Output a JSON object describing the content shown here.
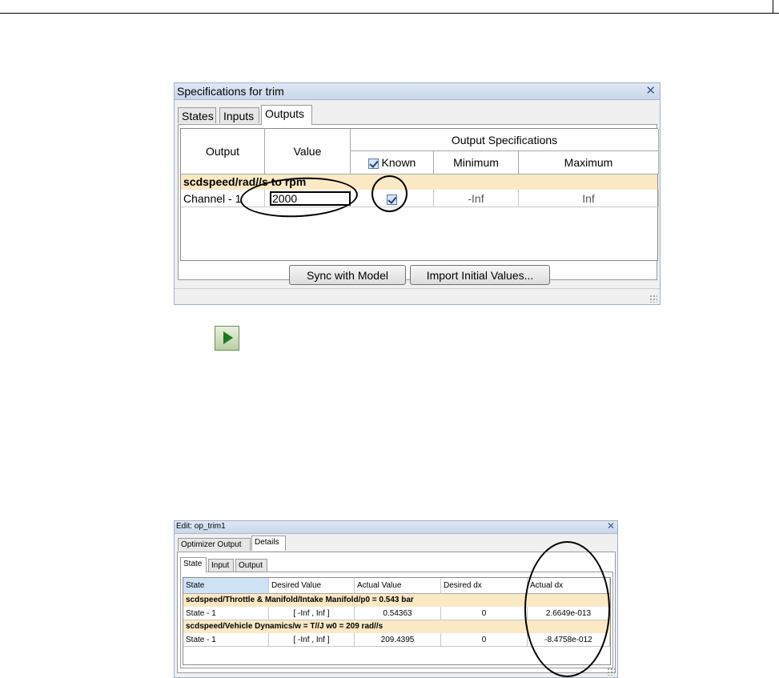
{
  "trim_dialog": {
    "title": "Specifications for trim",
    "close_glyph": "✕",
    "tabs": [
      {
        "label": "States"
      },
      {
        "label": "Inputs"
      },
      {
        "label": "Outputs"
      }
    ],
    "active_tab": "Outputs",
    "table": {
      "col_output": "Output",
      "col_value": "Value",
      "col_group": "Output Specifications",
      "col_known": "Known",
      "col_minimum": "Minimum",
      "col_maximum": "Maximum",
      "group_label": "scdspeed/rad//s to rpm",
      "row": {
        "output": "Channel - 1",
        "value": "2000",
        "known": true,
        "minimum": "-Inf",
        "maximum": "Inf"
      }
    },
    "buttons": {
      "sync": "Sync with Model",
      "import": "Import Initial Values..."
    }
  },
  "run_icon": "play-icon",
  "op_dialog": {
    "title": "Edit: op_trim1",
    "close_glyph": "✕",
    "tabs": [
      {
        "label": "Optimizer Output"
      },
      {
        "label": "Details"
      }
    ],
    "subtabs": [
      {
        "label": "State"
      },
      {
        "label": "Input"
      },
      {
        "label": "Output"
      }
    ],
    "columns": [
      "State",
      "Desired Value",
      "Actual Value",
      "Desired dx",
      "Actual dx"
    ],
    "groups": [
      {
        "label": "scdspeed/Throttle & Manifold/Intake Manifold/p0 = 0.543 bar",
        "row": [
          "State - 1",
          "[ -Inf , Inf ]",
          "0.54363",
          "0",
          "2.6649e-013"
        ]
      },
      {
        "label": "scdspeed/Vehicle Dynamics/w = T//J w0 = 209 rad//s",
        "row": [
          "State - 1",
          "[ -Inf , Inf ]",
          "209.4395",
          "0",
          "-8.4758e-012"
        ]
      }
    ]
  },
  "colors": {
    "group_row_bg": "#fbe9c6",
    "selected_header_bg": "#cfe3f7",
    "title_bar": "#c9d7ea"
  }
}
